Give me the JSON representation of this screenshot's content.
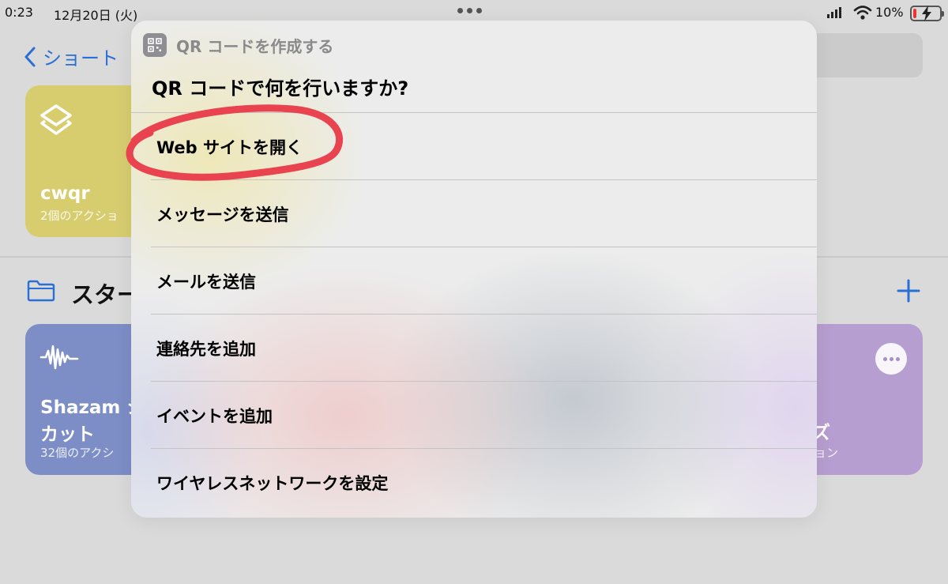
{
  "status_bar": {
    "time": "0:23",
    "date": "12月20日 (火)",
    "battery": "10%"
  },
  "background": {
    "back_label": "ショート",
    "cards": [
      {
        "title": "cwqr",
        "subtitle": "2個のアクショ",
        "color": "#d7cd6f"
      },
      {
        "title_line1": "Shazam シ",
        "title_line2": "カット",
        "subtitle": "32個のアクシ",
        "color": "#7d8ec6"
      },
      {
        "title_fragment": "ズ",
        "subtitle": "ョン",
        "color": "#b79ed0"
      }
    ],
    "section_title": "スター"
  },
  "sheet": {
    "app_title": "QR コードを作成する",
    "question": "QR コードで何を行いますか?",
    "options": [
      "Web サイトを開く",
      "メッセージを送信",
      "メールを送信",
      "連絡先を追加",
      "イベントを追加",
      "ワイヤレスネットワークを設定"
    ],
    "highlight_color": "#e8434f"
  }
}
